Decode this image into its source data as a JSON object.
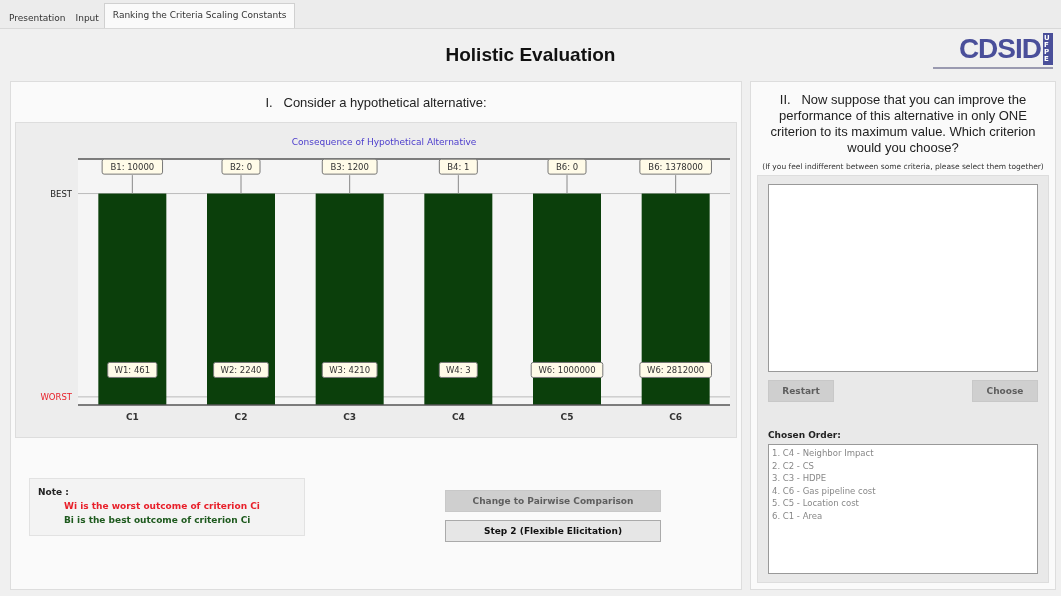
{
  "tabs": [
    {
      "label": "Presentation",
      "selected": false
    },
    {
      "label": "Input",
      "selected": false
    },
    {
      "label": "Ranking the Criteria Scaling Constants",
      "selected": true
    }
  ],
  "title": "Holistic Evaluation",
  "logo": {
    "text": "CDSID",
    "side": "UFPE"
  },
  "left_panel": {
    "heading": "I.   Consider a hypothetical alternative:",
    "chart": {
      "title": "Consequence of Hypothetical Alternative",
      "best_label": "BEST",
      "worst_label": "WORST",
      "criteria": [
        {
          "label": "C1",
          "best": "B1: 10000",
          "worst": "W1: 461"
        },
        {
          "label": "C2",
          "best": "B2: 0",
          "worst": "W2: 2240"
        },
        {
          "label": "C3",
          "best": "B3: 1200",
          "worst": "W3: 4210"
        },
        {
          "label": "C4",
          "best": "B4: 1",
          "worst": "W4: 3"
        },
        {
          "label": "C5",
          "best": "B6: 0",
          "worst": "W6: 1000000"
        },
        {
          "label": "C6",
          "best": "B6: 1378000",
          "worst": "W6: 2812000"
        }
      ]
    },
    "note": {
      "label": "Note :",
      "lines": [
        {
          "text": "Wi is the worst outcome of criterion Ci",
          "color": "#e8202a"
        },
        {
          "text": "Bi is the best outcome of criterion Ci",
          "color": "#1e5a1e"
        }
      ]
    },
    "buttons": [
      {
        "label": "Change to Pairwise Comparison",
        "disabled": true
      },
      {
        "label": "Step 2 (Flexible Elicitation)",
        "disabled": false
      }
    ]
  },
  "right_panel": {
    "heading": "II.   Now suppose that you can improve the performance of this alternative in only ONE criterion to its maximum value. Which criterion would you choose?",
    "hint": "(If you feel indifferent between some criteria, please select them together)",
    "buttons": [
      {
        "label": "Restart",
        "disabled": true
      },
      {
        "label": "Choose",
        "disabled": true
      }
    ],
    "order_label": "Chosen Order:",
    "chosen_order": [
      "1. C4 - Neighbor Impact",
      "2. C2 - CS",
      "3. C3 - HDPE",
      "4. C6 - Gas pipeline cost",
      "5. C5 - Location cost",
      "6. C1 - Area"
    ]
  }
}
